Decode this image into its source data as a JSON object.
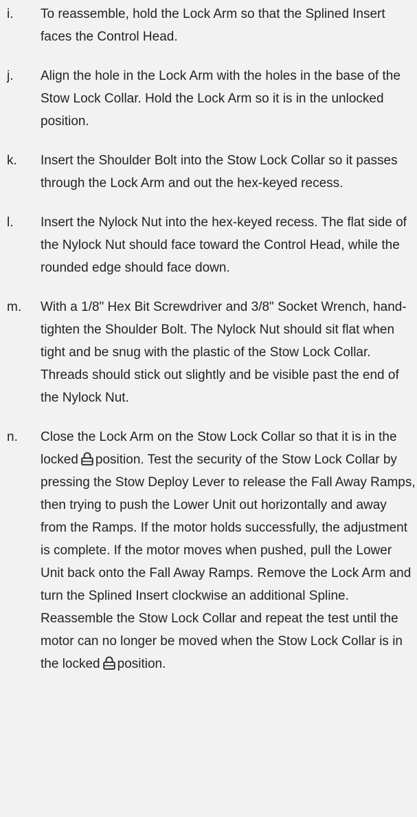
{
  "steps": [
    {
      "letter": "i.",
      "text": "To reassemble, hold the Lock Arm so that the Splined Insert faces the Control Head."
    },
    {
      "letter": "j.",
      "text": "Align the hole in the Lock Arm with the holes in the base of the Stow Lock Collar. Hold the Lock Arm so it is in the unlocked position."
    },
    {
      "letter": "k.",
      "text": "Insert the Shoulder Bolt into the Stow Lock Collar so it passes through the Lock Arm and out the hex-keyed recess."
    },
    {
      "letter": "l.",
      "text": "Insert the Nylock Nut into the hex-keyed recess. The flat side of the Nylock Nut should face toward the Control Head, while the rounded edge should face down."
    },
    {
      "letter": "m.",
      "text": "With a 1/8\" Hex Bit Screwdriver and 3/8\" Socket Wrench, hand-tighten the Shoulder Bolt. The Nylock Nut should sit flat when tight and be snug with the plastic of the Stow Lock Collar. Threads should stick out slightly and be visible past the end of the Nylock Nut."
    },
    {
      "letter": "n.",
      "text_part1": "Close the Lock Arm on the Stow Lock Collar so that it is in the locked",
      "text_part2": "position. Test the security of the Stow Lock Collar by pressing the Stow Deploy Lever to release the Fall Away Ramps, then trying to push the Lower Unit out horizontally and away from the Ramps. If the motor holds successfully, the adjustment is complete. If the motor moves when pushed, pull the Lower Unit back onto the Fall Away Ramps. Remove the Lock Arm and turn the Splined Insert clockwise an additional Spline. Reassemble the Stow Lock Collar and repeat the test until the motor can no longer be moved when the Stow Lock Collar is in the locked",
      "text_part3": "position."
    }
  ],
  "icons": {
    "lock": "padlock-locked-icon"
  }
}
